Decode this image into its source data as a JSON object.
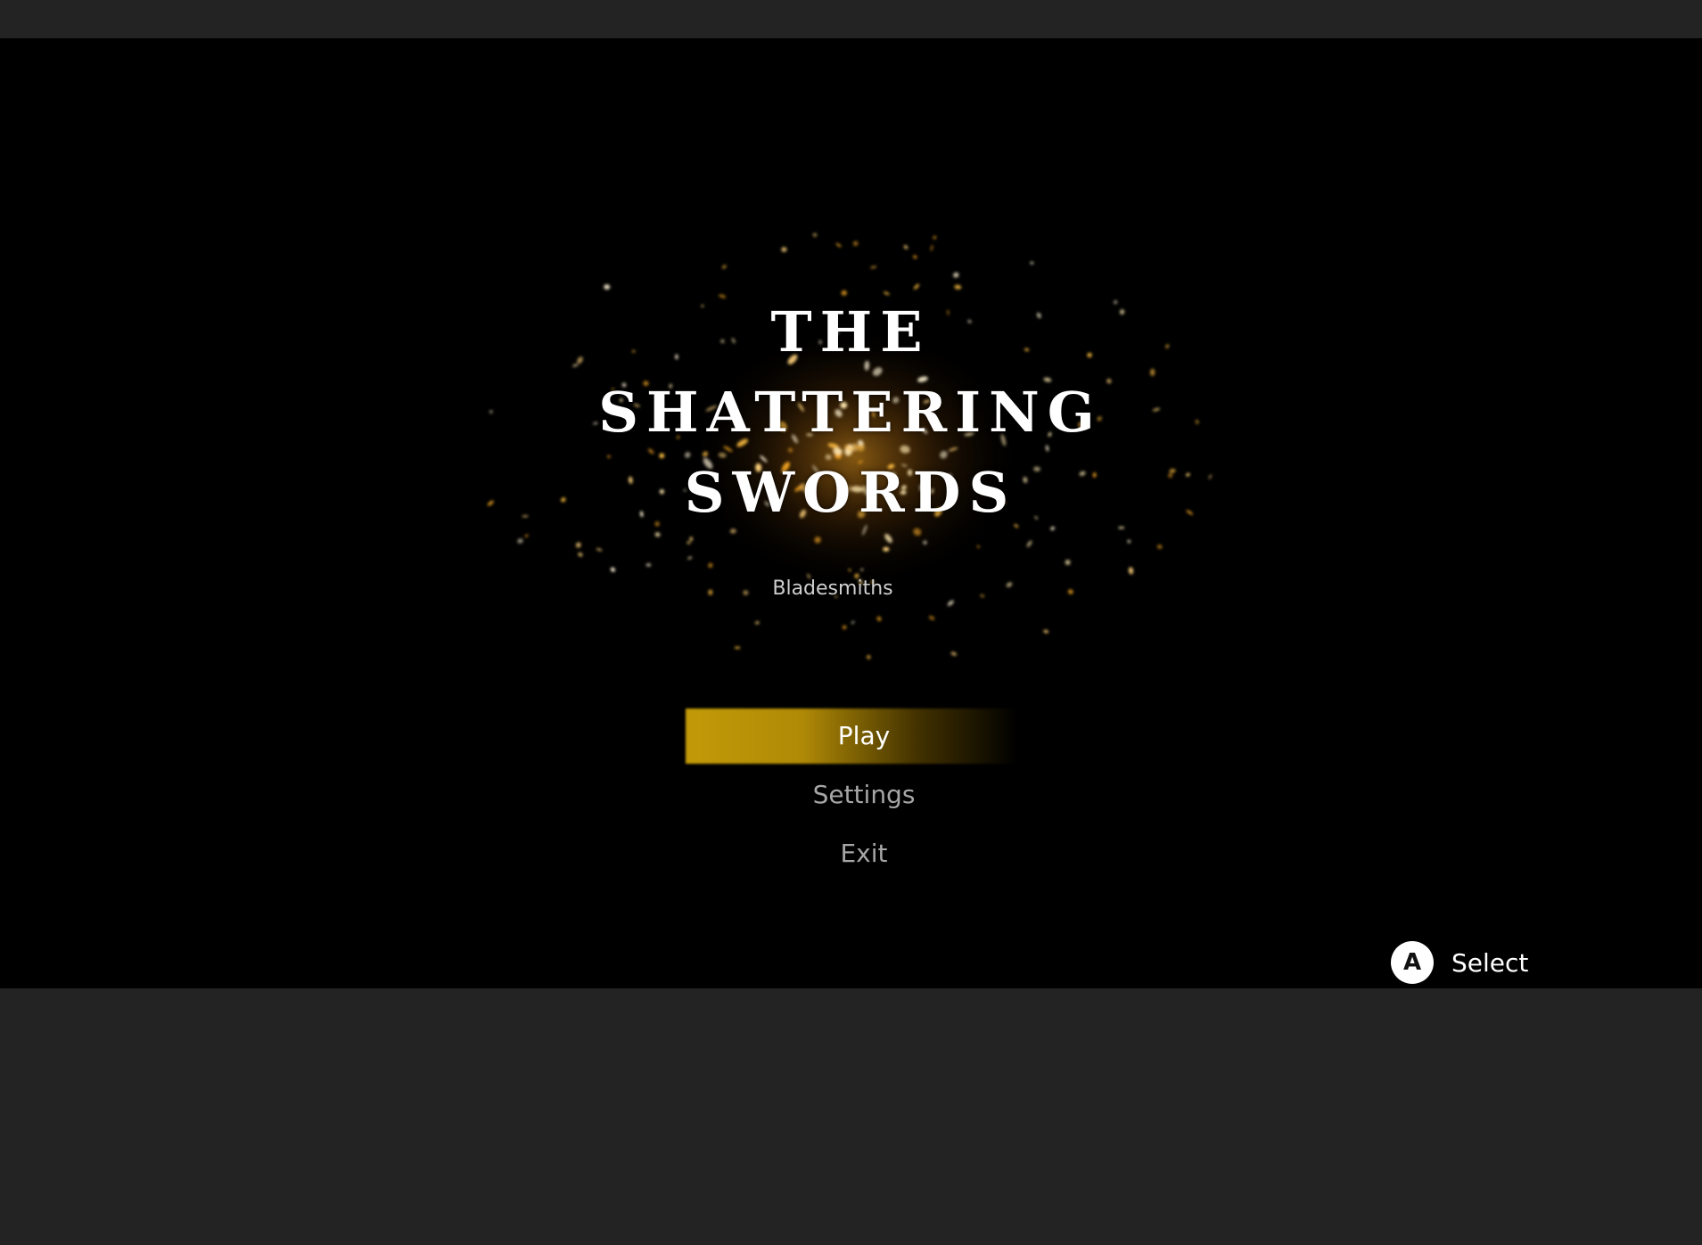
{
  "title": {
    "lines": [
      "THE",
      "SHATTERING",
      "SWORDS"
    ]
  },
  "studio": "Bladesmiths",
  "menu": {
    "items": [
      {
        "label": "Play",
        "selected": true
      },
      {
        "label": "Settings",
        "selected": false
      },
      {
        "label": "Exit",
        "selected": false
      }
    ]
  },
  "hint": {
    "button_glyph": "A",
    "label": "Select",
    "icon": "a-button-icon"
  },
  "colors": {
    "frame": "#232324",
    "background": "#000000",
    "accent": "#c29a08",
    "spark": "#f5a623",
    "text_selected": "#ffffff",
    "text_normal": "#a6a6a6"
  }
}
